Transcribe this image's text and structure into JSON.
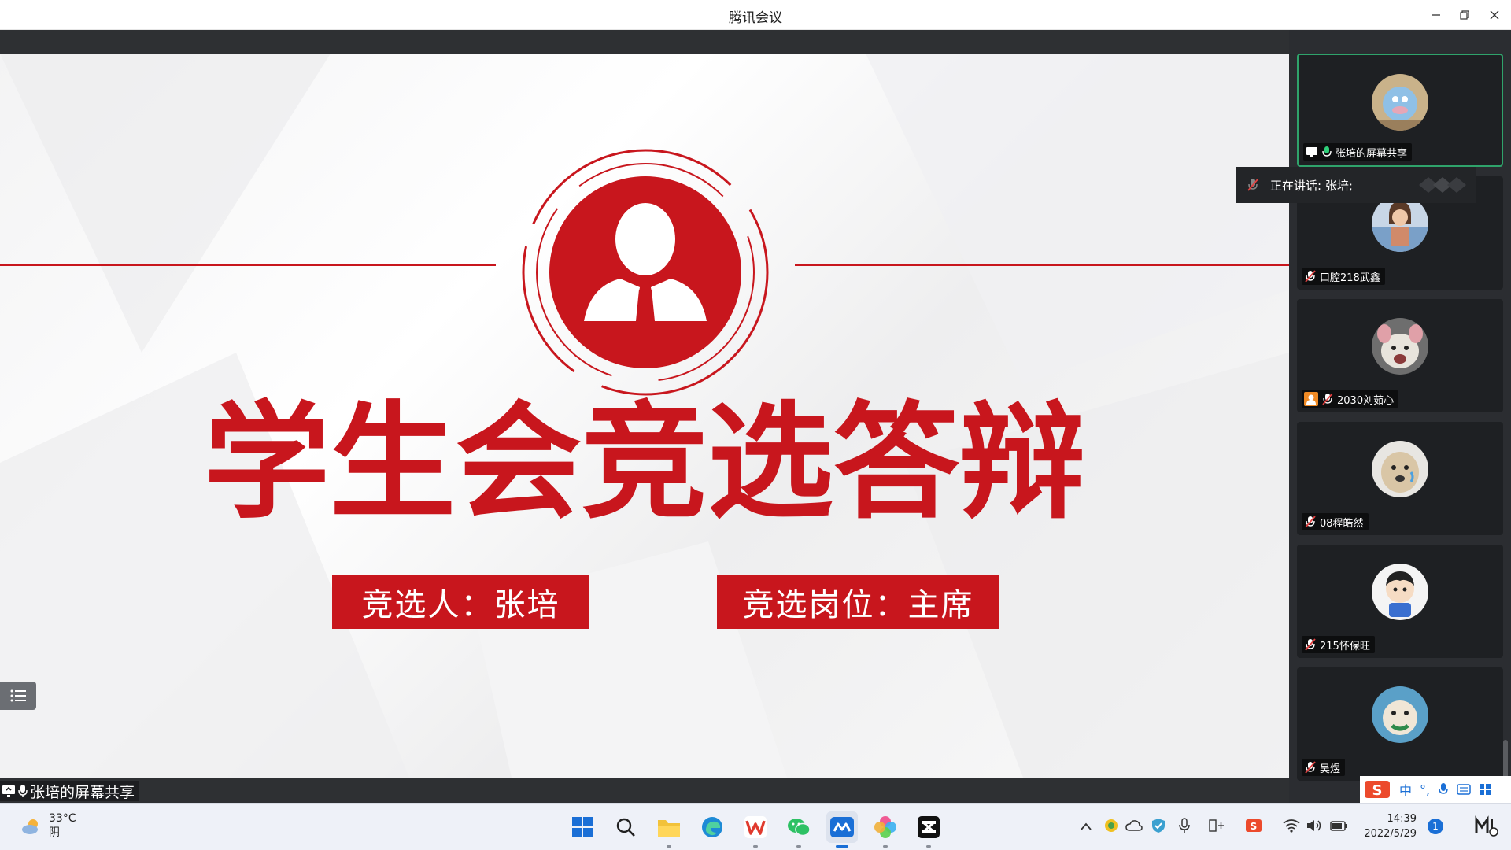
{
  "window": {
    "title": "腾讯会议",
    "controls": [
      "minimize",
      "restore",
      "close"
    ]
  },
  "slide": {
    "title": "学生会竞选答辩",
    "candidate": "竞选人：张培",
    "position": "竞选岗位：主席",
    "accent_color": "#c8161d"
  },
  "share_label": "张培的屏幕共享",
  "speaking": {
    "text": "正在讲话: 张培;"
  },
  "participants": [
    {
      "name": "张培的屏幕共享",
      "icon": "mic-on-icon",
      "share": true,
      "active": true
    },
    {
      "name": "口腔218武鑫",
      "icon": "mic-muted-icon"
    },
    {
      "name": "2030刘茹心",
      "icon": "mic-muted-icon",
      "host": true
    },
    {
      "name": "08程皓然",
      "icon": "mic-muted-icon"
    },
    {
      "name": "215怀保旺",
      "icon": "mic-muted-icon"
    },
    {
      "name": "吴煜",
      "icon": "mic-muted-icon"
    }
  ],
  "ime": {
    "lang": "中",
    "punct": "°,"
  },
  "taskbar": {
    "weather_temp": "33°C",
    "weather_desc": "阴",
    "time": "14:39",
    "date": "2022/5/29",
    "notification_count": "1"
  }
}
